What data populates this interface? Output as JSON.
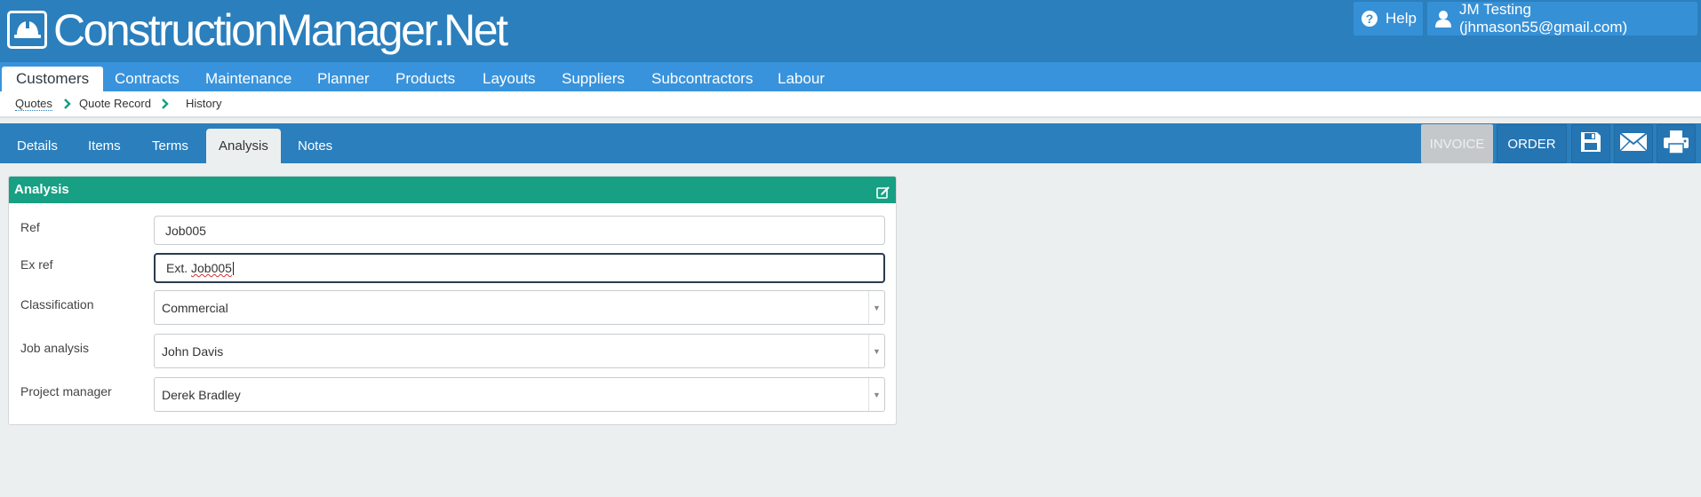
{
  "brand": {
    "name": "ConstructionManager.Net"
  },
  "header": {
    "help_label": "Help",
    "user_label": "JM Testing (jhmason55@gmail.com)"
  },
  "mainnav": {
    "items": [
      {
        "label": "Customers"
      },
      {
        "label": "Contracts"
      },
      {
        "label": "Maintenance"
      },
      {
        "label": "Planner"
      },
      {
        "label": "Products"
      },
      {
        "label": "Layouts"
      },
      {
        "label": "Suppliers"
      },
      {
        "label": "Subcontractors"
      },
      {
        "label": "Labour"
      }
    ],
    "active": "Customers"
  },
  "breadcrumb": [
    "Quotes",
    "Quote Record",
    "History"
  ],
  "record_tabs": {
    "items": [
      {
        "label": "Details"
      },
      {
        "label": "Items"
      },
      {
        "label": "Terms"
      },
      {
        "label": "Analysis"
      },
      {
        "label": "Notes"
      }
    ],
    "active": "Analysis"
  },
  "actions": {
    "invoice_label": "INVOICE",
    "order_label": "ORDER",
    "icons": [
      "save-icon",
      "email-icon",
      "print-icon"
    ]
  },
  "panel": {
    "title": "Analysis",
    "fields": {
      "ref": {
        "label": "Ref",
        "value": "Job005"
      },
      "ex_ref": {
        "label": "Ex ref",
        "value_prefix": "Ext. ",
        "value_word": "Job005"
      },
      "classification": {
        "label": "Classification",
        "value": "Commercial"
      },
      "job_analysis": {
        "label": "Job analysis",
        "value": "John Davis"
      },
      "project_manager": {
        "label": "Project manager",
        "value": "Derek Bradley"
      }
    }
  },
  "colors": {
    "header": "#2b7fbd",
    "nav": "#3893dc",
    "panel_header": "#17a083",
    "background": "#ecefef"
  }
}
